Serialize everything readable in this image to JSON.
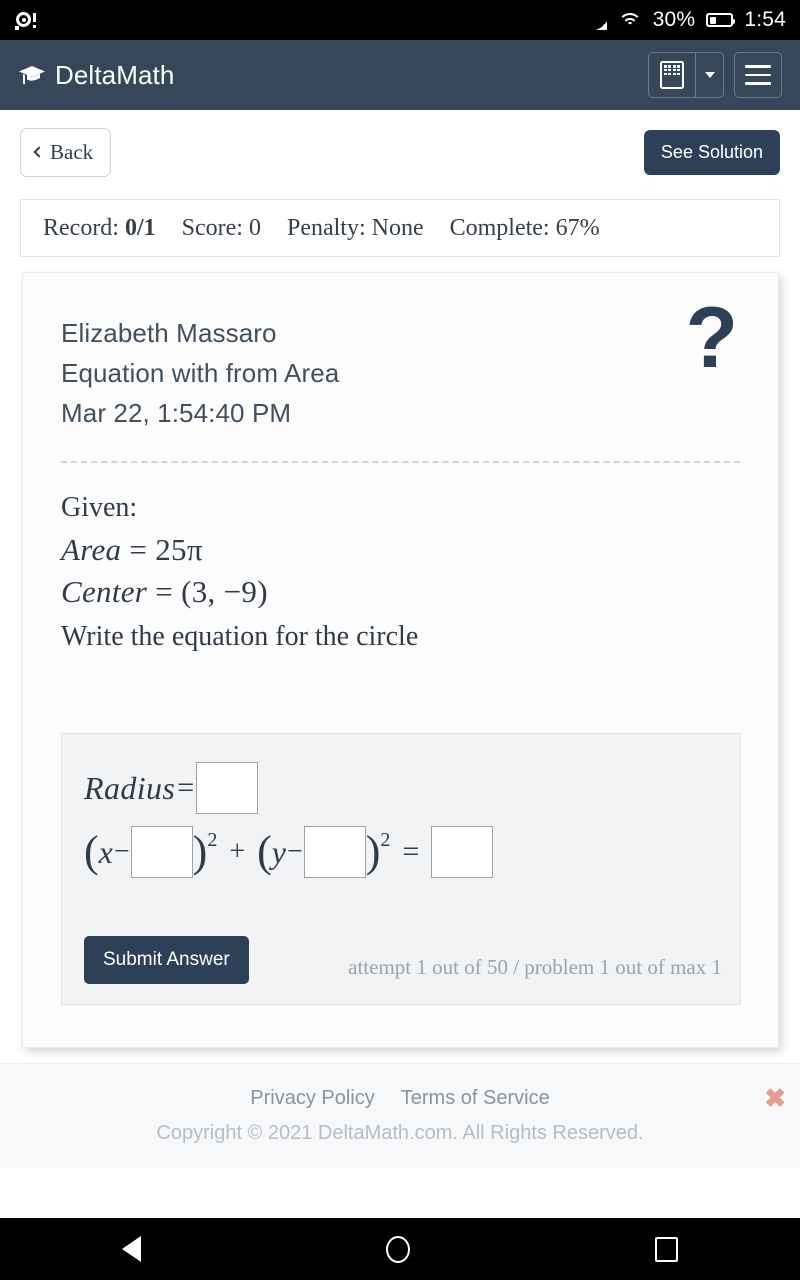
{
  "status_bar": {
    "left_icon": "alarm-icon",
    "dnd_icon": "moon-icon",
    "wifi_icon": "wifi-icon",
    "battery_percent": "30%",
    "battery_level": 30,
    "battery_icon": "battery-icon",
    "time": "1:54"
  },
  "header": {
    "logo_icon": "graduation-cap-icon",
    "brand": "DeltaMath",
    "calculator_icon": "calculator-icon",
    "calculator_caret_icon": "chevron-down-icon",
    "menu_icon": "hamburger-menu-icon",
    "background_color": "#354759"
  },
  "toolbar": {
    "back_label": "Back",
    "back_icon": "chevron-left-icon",
    "see_solution_label": "See Solution",
    "accent_color": "#2e4057"
  },
  "record_bar": {
    "record_label": "Record:",
    "record_value": "0/1",
    "score_label": "Score:",
    "score_value": "0",
    "penalty_label": "Penalty:",
    "penalty_value": "None",
    "complete_label": "Complete:",
    "complete_value": "67%"
  },
  "problem": {
    "student_name": "Elizabeth Massaro",
    "assignment_title": "Equation with from Area",
    "timestamp": "Mar 22, 1:54:40 PM",
    "help_icon": "question-mark-icon",
    "given_label": "Given:",
    "given_area": "Area = 25π",
    "area_lhs": "Area",
    "area_eq": "=",
    "area_rhs": "25π",
    "center_lhs": "Center",
    "center_eq": "=",
    "center_rhs": "(3, −9)",
    "instruction": "Write the equation for the circle"
  },
  "answer_form": {
    "radius_label": "Radius",
    "radius_equals": "=",
    "radius_value": "",
    "open_paren": "(",
    "close_paren": ")",
    "x_var": "x",
    "y_var": "y",
    "minus": "−",
    "exponent": "2",
    "plus": "+",
    "equals": "=",
    "h_value": "",
    "k_value": "",
    "r2_value": "",
    "submit_label": "Submit Answer",
    "attempt_text": "attempt 1 out of 50 / problem 1 out of max 1"
  },
  "footer": {
    "privacy_label": "Privacy Policy",
    "terms_label": "Terms of Service",
    "copyright": "Copyright © 2021 DeltaMath.com. All Rights Reserved.",
    "close_icon": "close-x-icon",
    "close_glyph": "✖",
    "close_color": "#e39d8e"
  },
  "nav_bar": {
    "back_icon": "triangle-back-icon",
    "home_icon": "circle-home-icon",
    "recents_icon": "square-recents-icon"
  }
}
